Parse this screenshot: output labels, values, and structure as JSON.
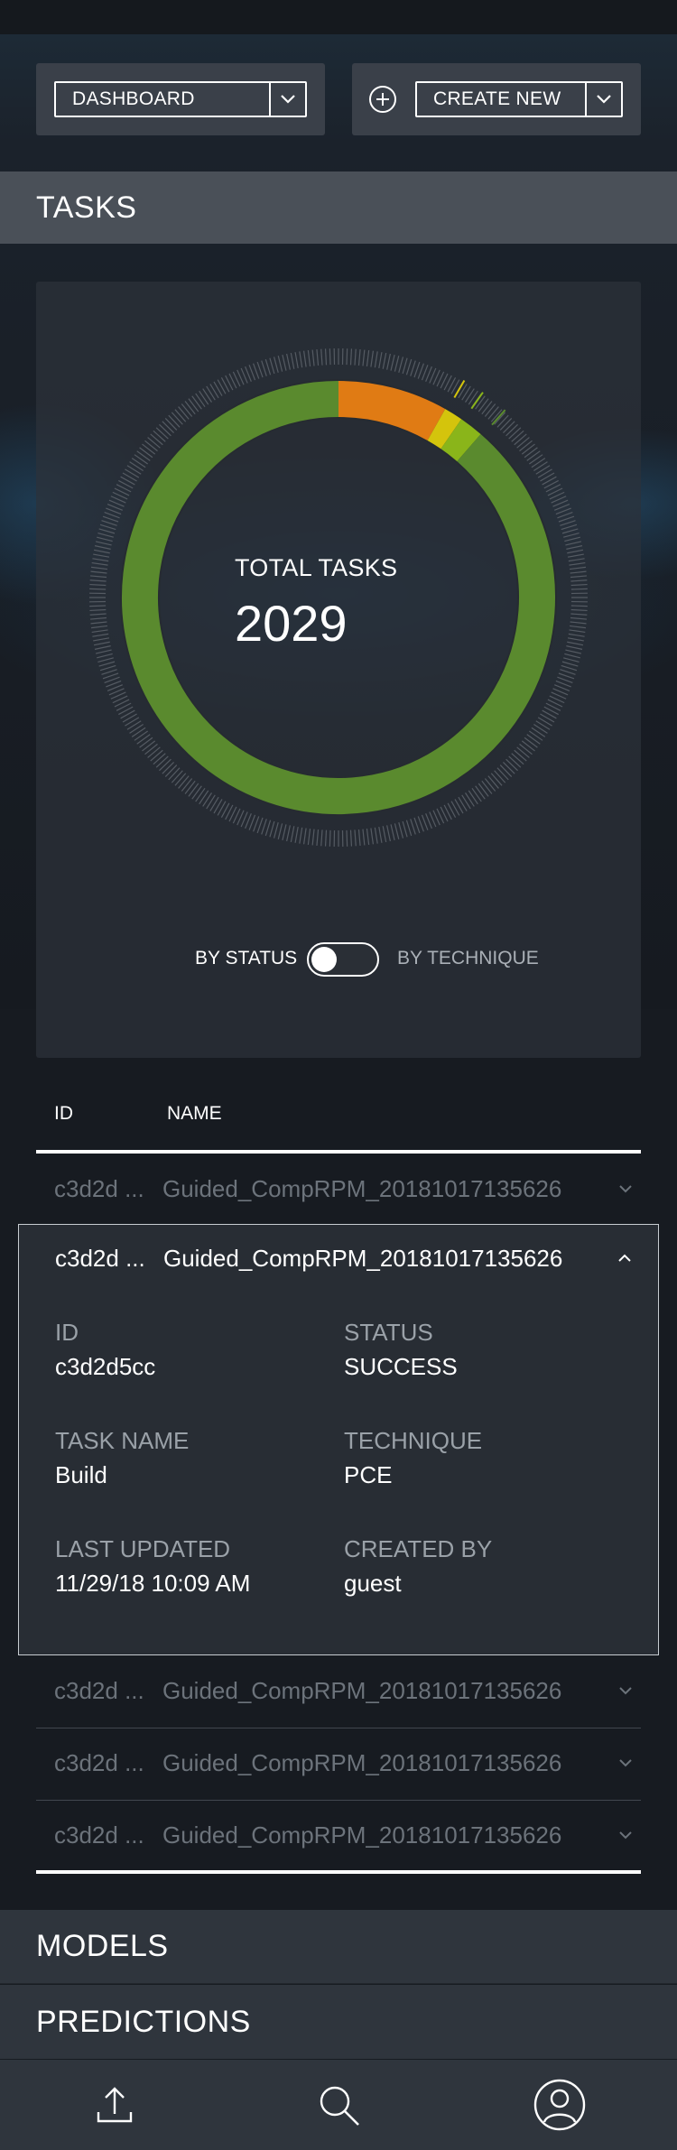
{
  "header": {
    "view_select_label": "DASHBOARD",
    "create_select_label": "CREATE NEW"
  },
  "sections": {
    "tasks": "TASKS",
    "models": "MODELS",
    "predictions": "PREDICTIONS"
  },
  "chart_data": {
    "type": "pie",
    "title": "TOTAL TASKS",
    "total": 2029,
    "segments": [
      {
        "color": "#e07b14",
        "fraction": 0.082
      },
      {
        "color": "#d4c40c",
        "fraction": 0.014
      },
      {
        "color": "#8ab51a",
        "fraction": 0.018
      },
      {
        "color": "#5a8a2e",
        "fraction": 0.886
      }
    ]
  },
  "chart": {
    "center_title": "TOTAL TASKS",
    "center_count": "2029"
  },
  "toggle": {
    "left_label": "BY STATUS",
    "right_label": "BY TECHNIQUE",
    "state": "off"
  },
  "table": {
    "col_id": "ID",
    "col_name": "NAME",
    "rows": [
      {
        "id": "c3d2d ...",
        "name": "Guided_CompRPM_20181017135626"
      },
      {
        "id": "c3d2d ...",
        "name": "Guided_CompRPM_20181017135626"
      },
      {
        "id": "c3d2d ...",
        "name": "Guided_CompRPM_20181017135626"
      },
      {
        "id": "c3d2d ...",
        "name": "Guided_CompRPM_20181017135626"
      },
      {
        "id": "c3d2d ...",
        "name": "Guided_CompRPM_20181017135626"
      }
    ],
    "expanded": {
      "id_label": "ID",
      "id_value": "c3d2d5cc",
      "status_label": "STATUS",
      "status_value": "SUCCESS",
      "task_label": "TASK NAME",
      "task_value": "Build",
      "technique_label": "TECHNIQUE",
      "technique_value": "PCE",
      "updated_label": "LAST UPDATED",
      "updated_value": "11/29/18 10:09 AM",
      "created_label": "CREATED BY",
      "created_value": "guest"
    }
  },
  "nav": {
    "icons": [
      "upload-icon",
      "search-icon",
      "user-icon"
    ]
  }
}
